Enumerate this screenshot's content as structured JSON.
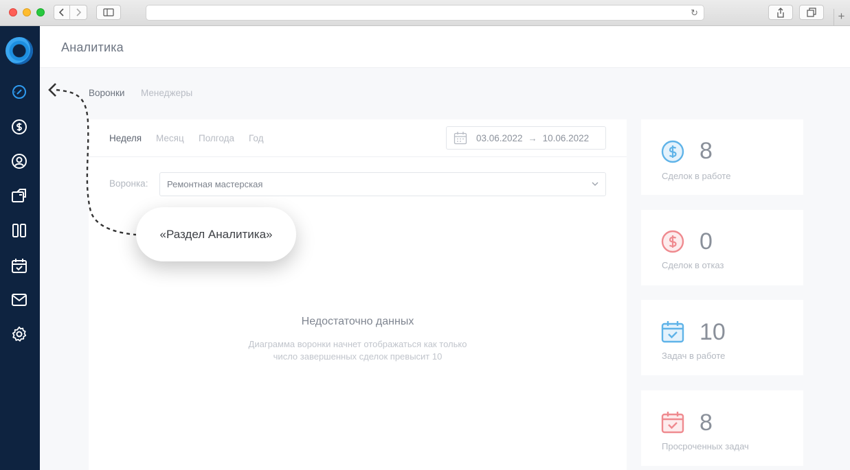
{
  "header": {
    "title": "Аналитика"
  },
  "tabs": [
    {
      "label": "Воронки",
      "active": true
    },
    {
      "label": "Менеджеры",
      "active": false
    }
  ],
  "periods": [
    {
      "label": "Неделя",
      "active": true
    },
    {
      "label": "Месяц",
      "active": false
    },
    {
      "label": "Полгода",
      "active": false
    },
    {
      "label": "Год",
      "active": false
    }
  ],
  "date_range": {
    "from": "03.06.2022",
    "arrow": "→",
    "to": "10.06.2022"
  },
  "funnel": {
    "label": "Воронка:",
    "value": "Ремонтная мастерская"
  },
  "empty_state": {
    "title": "Недостаточно данных",
    "line1": "Диаграмма воронки начнет отображаться как только",
    "line2": "число завершенных сделок превысит 10"
  },
  "stats": [
    {
      "value": "8",
      "label": "Сделок в работе",
      "icon": "dollar-circle-icon",
      "color": "#5fb3e8"
    },
    {
      "value": "0",
      "label": "Сделок в отказ",
      "icon": "dollar-circle-icon",
      "color": "#ef8a8f"
    },
    {
      "value": "10",
      "label": "Задач в работе",
      "icon": "calendar-check-icon",
      "color": "#5fb3e8"
    },
    {
      "value": "8",
      "label": "Просроченных задач",
      "icon": "calendar-check-icon",
      "color": "#ef8a8f"
    }
  ],
  "callout": {
    "text": "«Раздел Аналитика»"
  },
  "sidebar": {
    "icons": [
      "dashboard-gauge-icon",
      "dollar-icon",
      "user-icon",
      "folder-icon",
      "board-icon",
      "calendar-icon",
      "mail-icon",
      "settings-icon"
    ],
    "active_color": "#2f9bf0",
    "color": "#ffffff",
    "background": "#0e2340"
  }
}
